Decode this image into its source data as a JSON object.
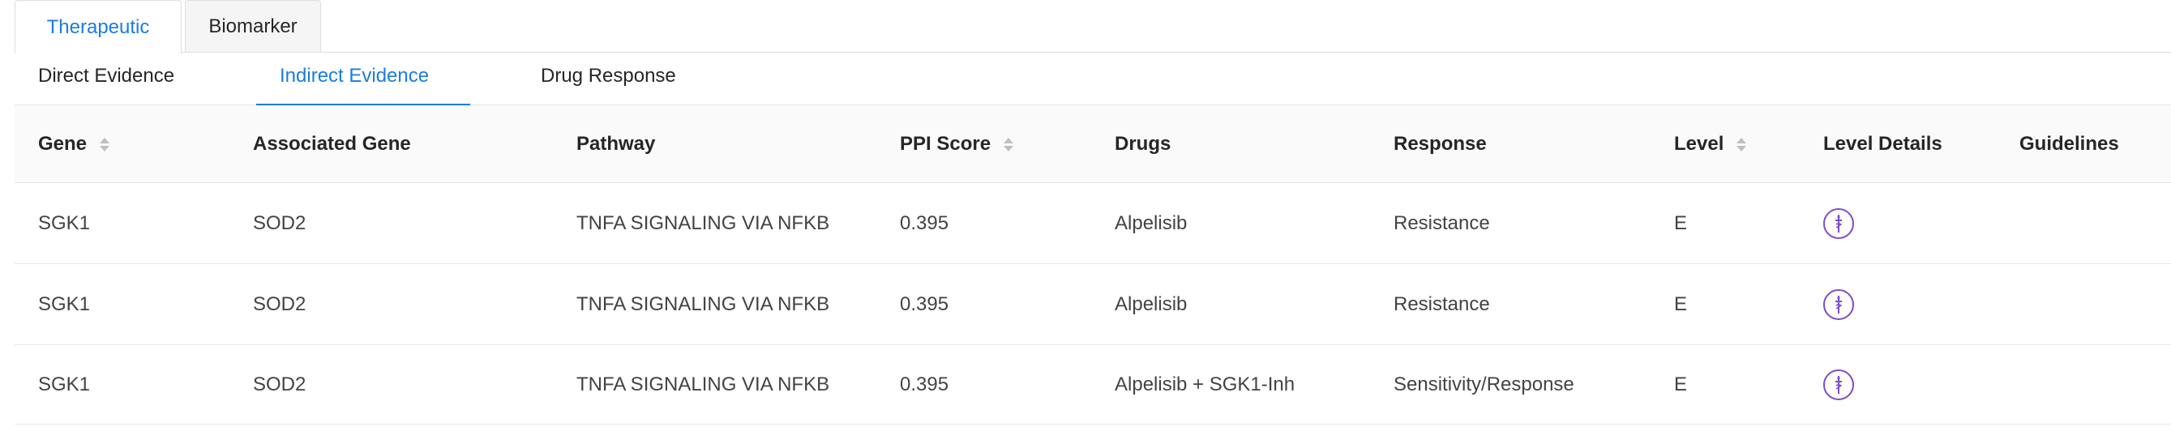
{
  "tabs": {
    "main": [
      {
        "label": "Therapeutic",
        "active": true
      },
      {
        "label": "Biomarker",
        "active": false
      }
    ],
    "sub": [
      {
        "label": "Direct Evidence",
        "active": false
      },
      {
        "label": "Indirect Evidence",
        "active": true
      },
      {
        "label": "Drug Response",
        "active": false
      }
    ]
  },
  "table": {
    "columns": [
      {
        "label": "Gene",
        "sortable": true
      },
      {
        "label": "Associated Gene",
        "sortable": false
      },
      {
        "label": "Pathway",
        "sortable": false
      },
      {
        "label": "PPI Score",
        "sortable": true
      },
      {
        "label": "Drugs",
        "sortable": false
      },
      {
        "label": "Response",
        "sortable": false
      },
      {
        "label": "Level",
        "sortable": true
      },
      {
        "label": "Level Details",
        "sortable": false
      },
      {
        "label": "Guidelines",
        "sortable": false
      }
    ],
    "rows": [
      {
        "gene": "SGK1",
        "associated_gene": "SOD2",
        "pathway": "TNFA SIGNALING VIA NFKB",
        "ppi_score": "0.395",
        "drugs": "Alpelisib",
        "response": "Resistance",
        "level": "E",
        "level_details_icon": "dagger-info-icon",
        "guidelines": ""
      },
      {
        "gene": "SGK1",
        "associated_gene": "SOD2",
        "pathway": "TNFA SIGNALING VIA NFKB",
        "ppi_score": "0.395",
        "drugs": "Alpelisib",
        "response": "Resistance",
        "level": "E",
        "level_details_icon": "dagger-info-icon",
        "guidelines": ""
      },
      {
        "gene": "SGK1",
        "associated_gene": "SOD2",
        "pathway": "TNFA SIGNALING VIA NFKB",
        "ppi_score": "0.395",
        "drugs": "Alpelisib + SGK1-Inh",
        "response": "Sensitivity/Response",
        "level": "E",
        "level_details_icon": "dagger-info-icon",
        "guidelines": ""
      }
    ]
  },
  "colors": {
    "accent": "#1a7de0",
    "level_icon": "#7c4dcc",
    "header_bg": "#fafafa",
    "border": "#e8e8e8"
  }
}
